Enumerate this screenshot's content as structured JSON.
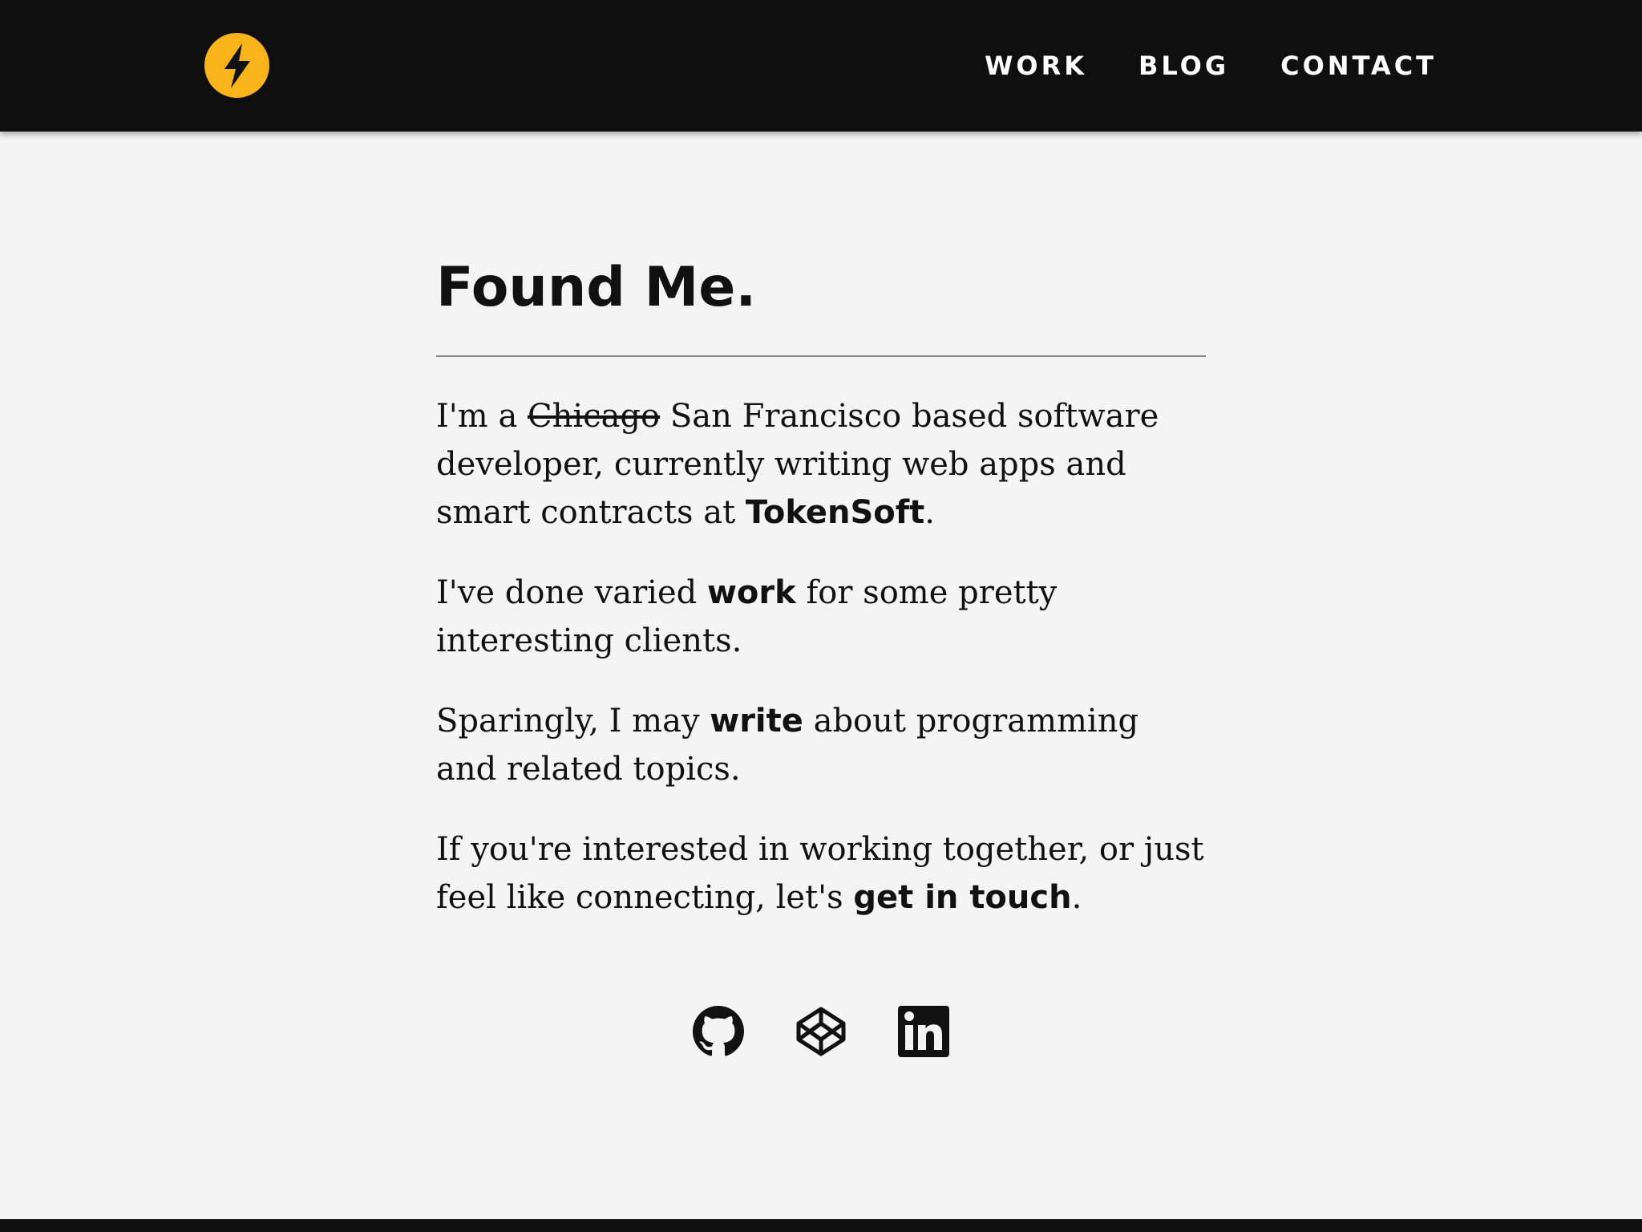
{
  "header": {
    "logo_icon": "lightning-bolt-icon",
    "logo_color": "#f9b31b",
    "background": "#0f0f10",
    "nav": [
      {
        "label": "WORK"
      },
      {
        "label": "BLOG"
      },
      {
        "label": "CONTACT"
      }
    ]
  },
  "main": {
    "title": "Found Me.",
    "paragraphs": {
      "p1": {
        "before": "I'm a ",
        "struck": "Chicago",
        "after": " San Francisco based software developer, currently writing web apps and smart contracts at ",
        "link": "TokenSoft",
        "end": "."
      },
      "p2": {
        "before": "I've done varied ",
        "link": "work",
        "after": " for some pretty interesting clients."
      },
      "p3": {
        "before": "Sparingly, I may ",
        "link": "write",
        "after": " about programming and related topics."
      },
      "p4": {
        "before": "If you're interested in working together, or just feel like connecting, let's ",
        "link": "get in touch",
        "end": "."
      }
    }
  },
  "social": [
    {
      "icon": "github-icon"
    },
    {
      "icon": "codepen-icon"
    },
    {
      "icon": "linkedin-icon"
    }
  ],
  "colors": {
    "page_background": "#f4f4f4",
    "text": "#111111",
    "accent": "#f9b31b"
  }
}
